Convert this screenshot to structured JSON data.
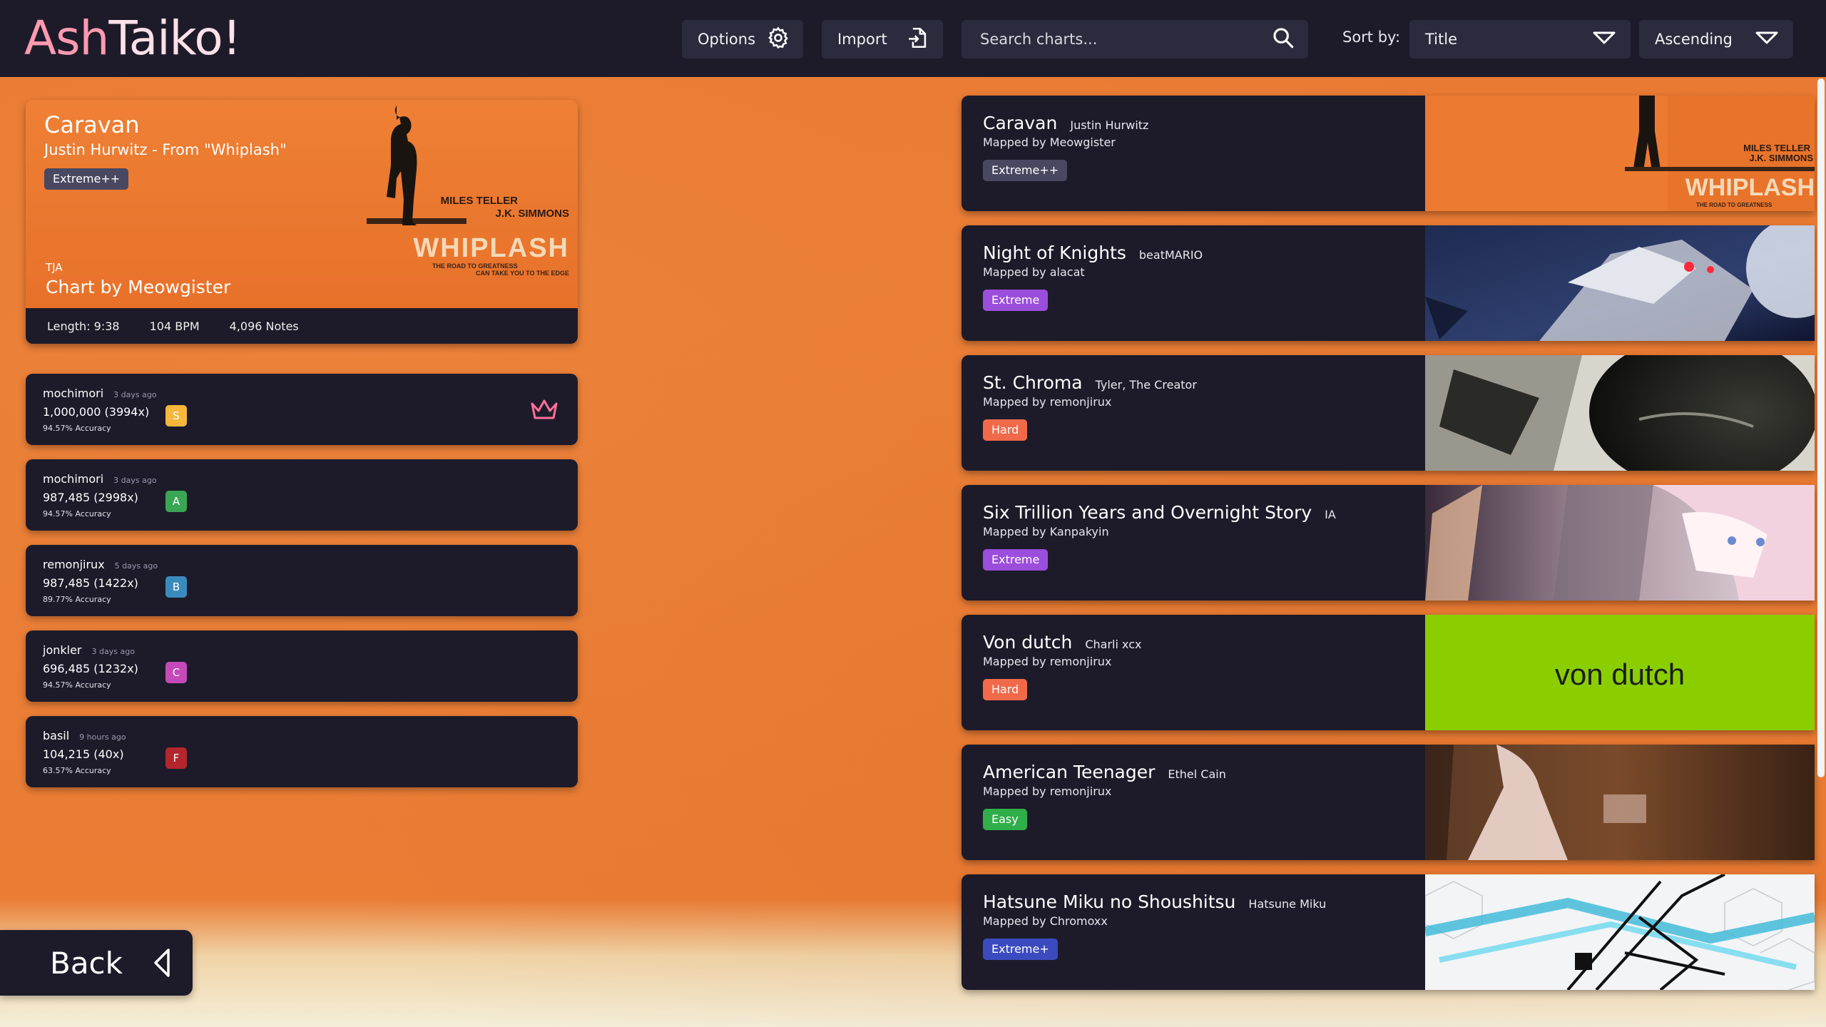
{
  "app": {
    "logo_part1": "Ash",
    "logo_part2": "Taiko!"
  },
  "toolbar": {
    "options_label": "Options",
    "import_label": "Import",
    "search_placeholder": "Search charts...",
    "sort_label": "Sort by:",
    "sort_field": "Title",
    "sort_order": "Ascending"
  },
  "selected": {
    "title": "Caravan",
    "artist_line": "Justin Hurwitz - From \"Whiplash\"",
    "difficulty": "Extreme++",
    "format": "TJA",
    "charter_line": "Chart by Meowgister",
    "length": "Length: 9:38",
    "bpm": "104 BPM",
    "notes": "4,096 Notes",
    "art_line1": "MILES TELLER",
    "art_line2": "J.K. SIMMONS",
    "art_title": "WHIPLASH",
    "art_tag1": "THE ROAD TO GREATNESS",
    "art_tag2": "CAN TAKE YOU TO THE EDGE"
  },
  "scores": [
    {
      "player": "mochimori",
      "when": "3 days ago",
      "points": "1,000,000 (3994x)",
      "accuracy": "94.57% Accuracy",
      "grade": "S",
      "grade_color": "#f6b73c",
      "crown": true
    },
    {
      "player": "mochimori",
      "when": "3 days ago",
      "points": "987,485 (2998x)",
      "accuracy": "94.57% Accuracy",
      "grade": "A",
      "grade_color": "#3aa655"
    },
    {
      "player": "remonjirux",
      "when": "5 days ago",
      "points": "987,485 (1422x)",
      "accuracy": "89.77% Accuracy",
      "grade": "B",
      "grade_color": "#3a8bbd"
    },
    {
      "player": "jonkler",
      "when": "3 days ago",
      "points": "696,485 (1232x)",
      "accuracy": "94.57% Accuracy",
      "grade": "C",
      "grade_color": "#c44ab9"
    },
    {
      "player": "basil",
      "when": "9 hours ago",
      "points": "104,215 (40x)",
      "accuracy": "63.57% Accuracy",
      "grade": "F",
      "grade_color": "#b3262c"
    }
  ],
  "back_label": "Back",
  "songs": [
    {
      "title": "Caravan",
      "artist": "Justin Hurwitz",
      "mapper": "Mapped by Meowgister",
      "difficulty": "Extreme++",
      "diff_color": "#4a4860",
      "art": "whiplash"
    },
    {
      "title": "Night of Knights",
      "artist": "beatMARIO",
      "mapper": "Mapped by alacat",
      "difficulty": "Extreme",
      "diff_color": "#9b4ddb",
      "art": "night"
    },
    {
      "title": "St. Chroma",
      "artist": "Tyler, The Creator",
      "mapper": "Mapped by remonjirux",
      "difficulty": "Hard",
      "diff_color": "#f06a4a",
      "art": "chroma"
    },
    {
      "title": "Six Trillion Years and Overnight Story",
      "artist": "IA",
      "mapper": "Mapped by Kanpakyin",
      "difficulty": "Extreme",
      "diff_color": "#9b4ddb",
      "art": "ia"
    },
    {
      "title": "Von dutch",
      "artist": "Charli xcx",
      "mapper": "Mapped by remonjirux",
      "difficulty": "Hard",
      "diff_color": "#f06a4a",
      "art": "vondutch",
      "art_text": "von dutch"
    },
    {
      "title": "American Teenager",
      "artist": "Ethel Cain",
      "mapper": "Mapped by remonjirux",
      "difficulty": "Easy",
      "diff_color": "#2fae4a",
      "art": "teenager"
    },
    {
      "title": "Hatsune Miku no Shoushitsu",
      "artist": "Hatsune Miku",
      "mapper": "Mapped by Chromoxx",
      "difficulty": "Extreme+",
      "diff_color": "#3b4bbf",
      "art": "miku"
    }
  ],
  "colors": {
    "panel": "#1d1b2a",
    "control": "#2c2a3d",
    "background": "#ea7c34",
    "crown": "#ff6f9a",
    "extreme_pp_badge": "#4a4860"
  }
}
